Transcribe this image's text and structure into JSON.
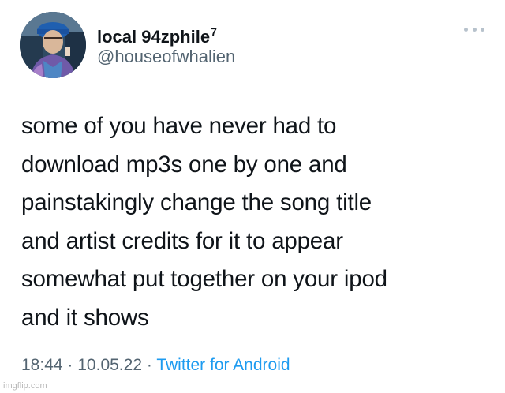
{
  "tweet": {
    "author": {
      "display_name": "local 94zphile",
      "display_name_superscript": "7",
      "handle": "@houseofwhalien"
    },
    "text_lines": [
      "some of you have never had to",
      "download mp3s one by one and",
      "painstakingly change the song title",
      "and artist credits for it to appear",
      "somewhat put together on your ipod",
      "and it shows"
    ],
    "time": "18:44",
    "separator": "·",
    "date": "10.05.22",
    "source": "Twitter for Android",
    "more_icon": "more-horizontal-icon"
  },
  "watermark": {
    "text": "imgflip.com"
  },
  "colors": {
    "text_primary": "#0f1419",
    "text_secondary": "#536471",
    "link": "#1d9bf0",
    "background": "#ffffff"
  }
}
